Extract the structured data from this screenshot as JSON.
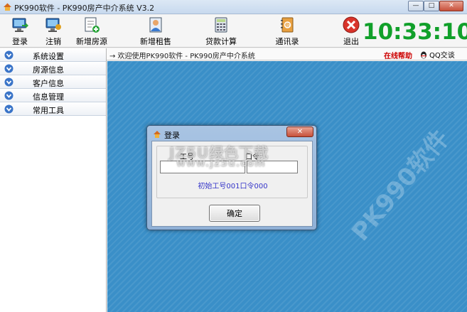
{
  "window": {
    "title": "PK990软件 - PK990房产中介系统 V3.2",
    "min_label": "—",
    "max_label": "□",
    "close_label": "✕"
  },
  "toolbar": {
    "items": [
      {
        "label": "登录",
        "icon": "login-monitor-icon"
      },
      {
        "label": "注销",
        "icon": "logout-monitor-icon"
      },
      {
        "label": "新增房源",
        "icon": "add-listing-icon"
      },
      {
        "label": "新增租售",
        "icon": "add-rental-icon"
      },
      {
        "label": "贷款计算",
        "icon": "calculator-icon"
      },
      {
        "label": "通讯录",
        "icon": "address-book-icon"
      },
      {
        "label": "退出",
        "icon": "exit-icon"
      }
    ],
    "clock": "10:33:10"
  },
  "strip": {
    "welcome": "→ 欢迎使用PK990软件 - PK990房产中介系统",
    "help": "在线帮助",
    "qq": "QQ交谈"
  },
  "sidebar": {
    "items": [
      {
        "label": "系统设置"
      },
      {
        "label": "房源信息"
      },
      {
        "label": "客户信息"
      },
      {
        "label": "信息管理"
      },
      {
        "label": "常用工具"
      }
    ]
  },
  "main": {
    "watermark": "PK990软件"
  },
  "dialog": {
    "title": "登录",
    "close_label": "✕",
    "user_label": "工号",
    "pass_label": "口令",
    "user_value": "",
    "pass_value": "",
    "hint": "初始工号001口令000",
    "ok_label": "确定",
    "overlay_1": "JZ5U绿色下载",
    "overlay_2": "www.jz5u.com"
  },
  "colors": {
    "clock": "#11a02a",
    "help": "#cc0000",
    "main_bg": "#3a8fc8",
    "hint": "#3434c8"
  }
}
